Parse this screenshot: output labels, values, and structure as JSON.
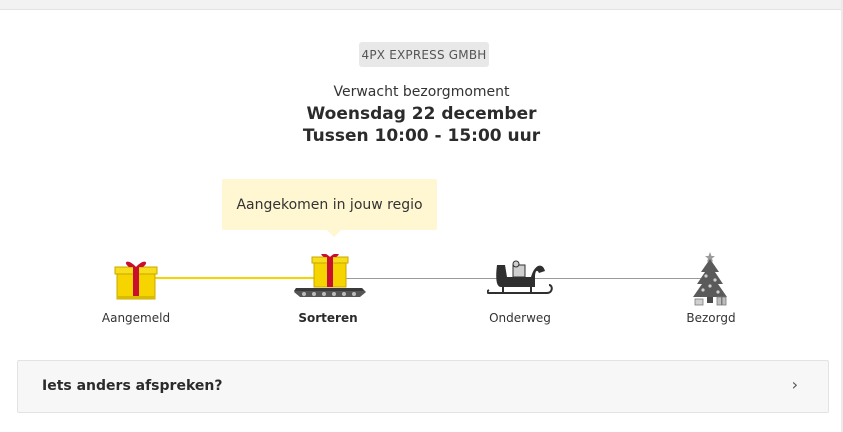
{
  "carrier": {
    "name": "4PX EXPRESS GMBH"
  },
  "delivery": {
    "label": "Verwacht bezorgmoment",
    "date": "Woensdag 22 december",
    "window": "Tussen 10:00 - 15:00 uur"
  },
  "status": {
    "tooltip": "Aangekomen in jouw regio"
  },
  "steps": [
    {
      "label": "Aangemeld",
      "icon": "gift-icon",
      "done": true
    },
    {
      "label": "Sorteren",
      "icon": "conveyor-gift-icon",
      "active": true
    },
    {
      "label": "Onderweg",
      "icon": "sleigh-icon",
      "done": false
    },
    {
      "label": "Bezorgd",
      "icon": "christmas-tree-icon",
      "done": false
    }
  ],
  "action": {
    "label": "Iets anders afspreken?",
    "icon": "chevron-right-icon"
  },
  "colors": {
    "progress": "#f5d400",
    "tooltip_bg": "#fff6d2",
    "gift": "#f5d400",
    "ribbon": "#c8102e"
  }
}
